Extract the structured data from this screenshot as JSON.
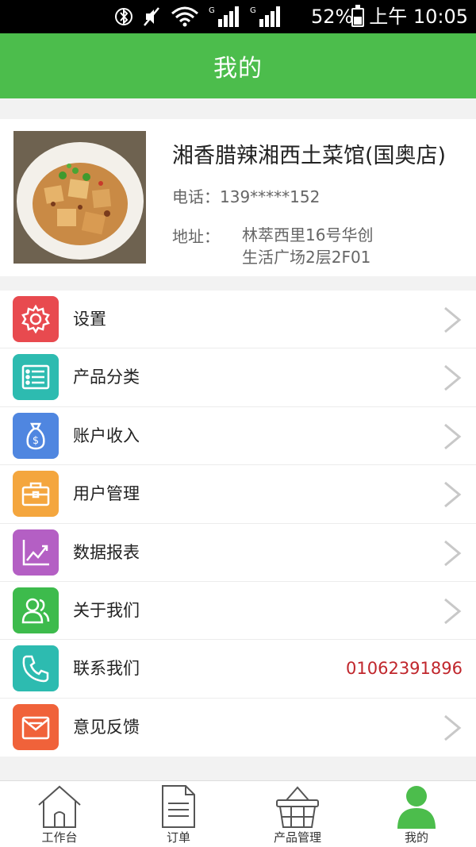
{
  "status_bar": {
    "battery": "52%",
    "time": "上午 10:05",
    "icons": [
      "bluetooth-icon",
      "mute-icon",
      "wifi-icon",
      "signal-icon",
      "signal-icon",
      "battery-icon"
    ]
  },
  "header": {
    "title": "我的"
  },
  "store": {
    "name": "湘香腊辣湘西土菜馆(国奥店)",
    "phone": "电话：139*****152",
    "address_label": "地址：",
    "address_line1": "林萃西里16号华创",
    "address_line2": "生活广场2层2F01"
  },
  "menu": {
    "items": [
      {
        "label": "设置",
        "icon": "gear-icon",
        "color": "#e84a4f"
      },
      {
        "label": "产品分类",
        "icon": "list-icon",
        "color": "#2dbbb0"
      },
      {
        "label": "账户收入",
        "icon": "money-bag-icon",
        "color": "#4f86e0"
      },
      {
        "label": "用户管理",
        "icon": "briefcase-icon",
        "color": "#f4a63e"
      },
      {
        "label": "数据报表",
        "icon": "chart-icon",
        "color": "#b45fc4"
      },
      {
        "label": "关于我们",
        "icon": "people-icon",
        "color": "#3dbb4c"
      },
      {
        "label": "联系我们",
        "icon": "phone-icon",
        "color": "#2dbbb0",
        "value": "01062391896"
      },
      {
        "label": "意见反馈",
        "icon": "envelope-icon",
        "color": "#f0623a"
      }
    ]
  },
  "tabs": {
    "items": [
      {
        "label": "工作台",
        "icon": "home-icon"
      },
      {
        "label": "订单",
        "icon": "document-icon"
      },
      {
        "label": "产品管理",
        "icon": "basket-icon"
      },
      {
        "label": "我的",
        "icon": "user-icon",
        "active": true
      }
    ]
  },
  "colors": {
    "primary": "#4cbd4c",
    "phone_text": "#c0262c"
  }
}
